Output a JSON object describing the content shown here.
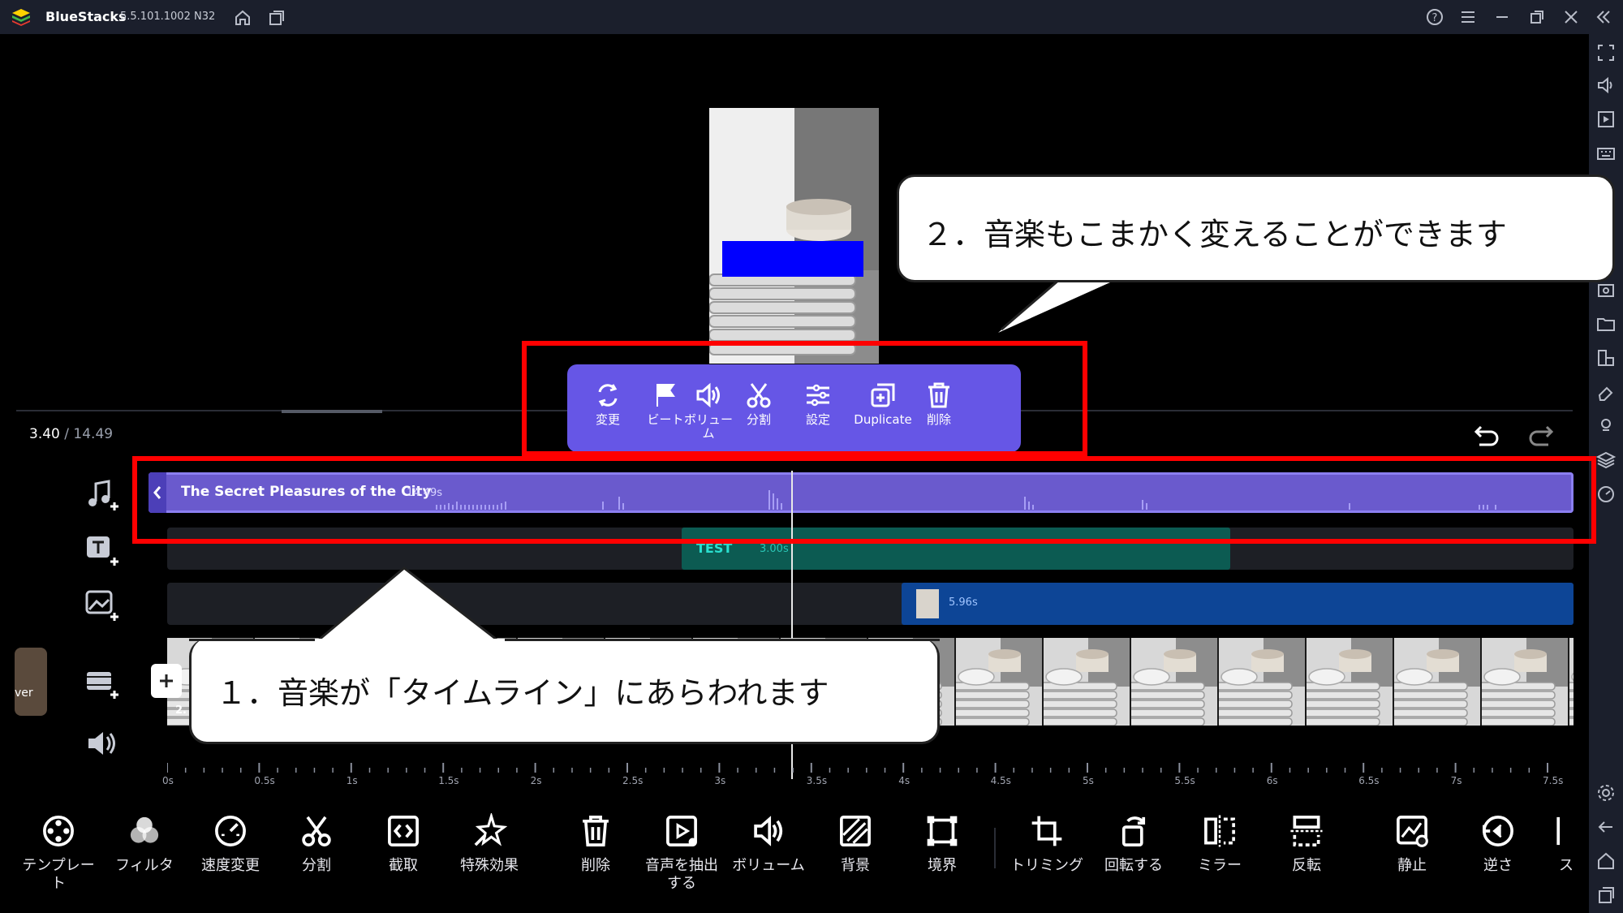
{
  "titlebar": {
    "app_name": "BlueStacks",
    "version": "5.5.101.1002 N32",
    "icons": [
      "home-icon",
      "multi-instance-icon",
      "help-icon",
      "menu-icon",
      "minimize-icon",
      "restore-icon",
      "close-icon",
      "collapse-sidebar-icon"
    ]
  },
  "preview": {
    "overlay_color": "#0000ff"
  },
  "time": {
    "current": "3.40",
    "separator": " / ",
    "total": "14.49"
  },
  "music_clip": {
    "title": "The Secret Pleasures of the City",
    "duration": "14.49s"
  },
  "text_clip": {
    "label": "TEST",
    "duration": "3.00s"
  },
  "sticker_clip": {
    "duration": "5.96s"
  },
  "video_clip": {
    "badge": "2."
  },
  "left_thumb": {
    "label": "ver"
  },
  "popup": {
    "items": [
      {
        "label": "変更",
        "icon": "replace-icon"
      },
      {
        "label": "ビート",
        "icon": "flag-icon"
      },
      {
        "label": "ボリュー\nム",
        "icon": "volume-icon"
      },
      {
        "label": "分割",
        "icon": "scissors-icon"
      },
      {
        "label": "設定",
        "icon": "sliders-icon"
      },
      {
        "label": "Duplicate",
        "icon": "duplicate-icon"
      },
      {
        "label": "削除",
        "icon": "trash-icon"
      }
    ]
  },
  "callouts": {
    "one": "１．音楽が「タイムライン」にあらわれます",
    "two": "２．音楽もこまかく変えることができます"
  },
  "ruler": [
    "0s",
    "0.5s",
    "1s",
    "1.5s",
    "2s",
    "2.5s",
    "3s",
    "3.5s",
    "4s",
    "4.5s",
    "5s",
    "5.5s",
    "6s",
    "6.5s",
    "7s",
    "7.5s"
  ],
  "bottom_toolbar": [
    {
      "label": "テンプレー\nト",
      "icon": "template-icon"
    },
    {
      "label": "フィルタ",
      "icon": "filter-icon"
    },
    {
      "label": "速度変更",
      "icon": "speed-icon"
    },
    {
      "label": "分割",
      "icon": "scissors-icon"
    },
    {
      "label": "截取",
      "icon": "trim-code-icon"
    },
    {
      "label": "特殊効果",
      "icon": "effects-icon"
    },
    {
      "label": "削除",
      "icon": "trash-icon"
    },
    {
      "label": "音声を抽出\nする",
      "icon": "extract-audio-icon"
    },
    {
      "label": "ボリューム",
      "icon": "volume-icon"
    },
    {
      "label": "背景",
      "icon": "background-icon"
    },
    {
      "label": "境界",
      "icon": "border-icon"
    },
    {
      "label": "トリミング",
      "icon": "crop-icon"
    },
    {
      "label": "回転する",
      "icon": "rotate-icon"
    },
    {
      "label": "ミラー",
      "icon": "mirror-icon"
    },
    {
      "label": "反転",
      "icon": "flip-icon"
    },
    {
      "label": "静止",
      "icon": "freeze-icon"
    },
    {
      "label": "逆さ",
      "icon": "reverse-icon"
    },
    {
      "label": "ス",
      "icon": "more-icon"
    }
  ]
}
